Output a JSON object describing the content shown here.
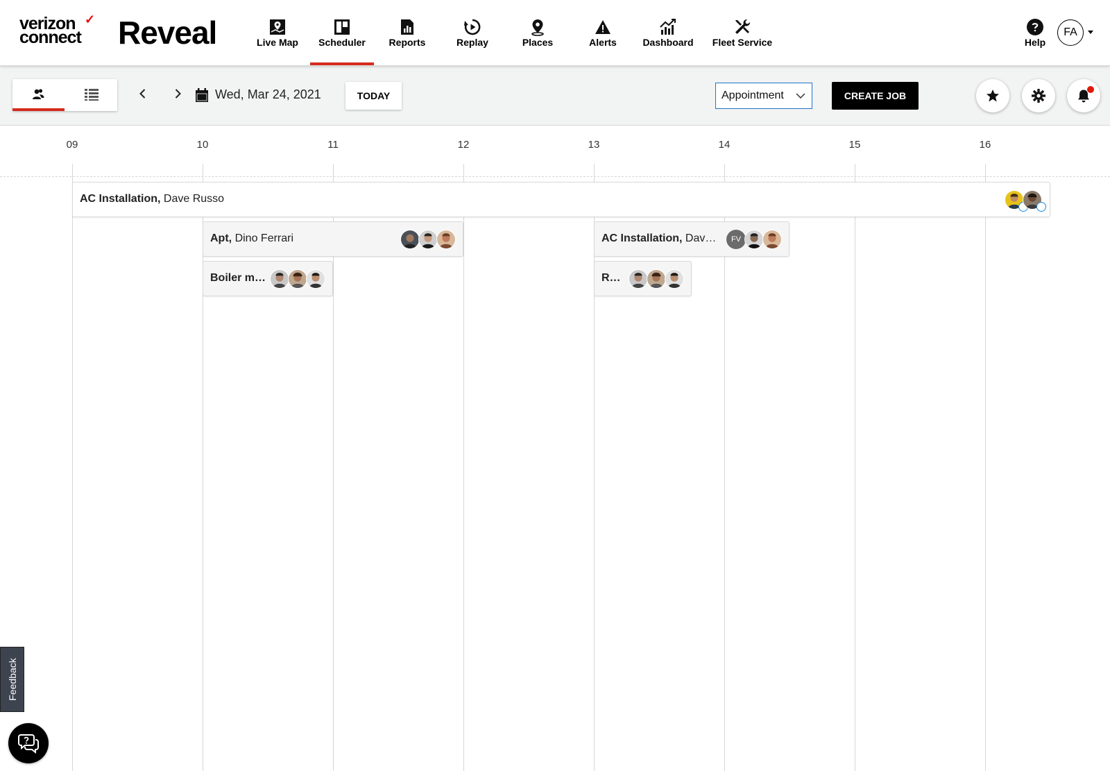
{
  "brand": {
    "line1": "verizon",
    "line2": "connect",
    "check": "✓",
    "product": "Reveal"
  },
  "nav": [
    {
      "label": "Live Map",
      "icon": "map-icon"
    },
    {
      "label": "Scheduler",
      "icon": "scheduler-icon",
      "active": true
    },
    {
      "label": "Reports",
      "icon": "reports-icon"
    },
    {
      "label": "Replay",
      "icon": "replay-icon"
    },
    {
      "label": "Places",
      "icon": "places-icon"
    },
    {
      "label": "Alerts",
      "icon": "alert-icon"
    },
    {
      "label": "Dashboard",
      "icon": "dashboard-icon"
    },
    {
      "label": "Fleet Service",
      "icon": "wrench-icon"
    }
  ],
  "help": {
    "label": "Help"
  },
  "user": {
    "initials": "FA"
  },
  "toolbar": {
    "date": "Wed, Mar 24, 2021",
    "today_label": "TODAY",
    "job_type": "Appointment",
    "create_label": "CREATE JOB"
  },
  "timeline": {
    "hours": [
      "09",
      "10",
      "11",
      "12",
      "13",
      "14",
      "15",
      "16"
    ]
  },
  "jobs": [
    {
      "title": "AC Installation,",
      "customer": "Dave Russo"
    },
    {
      "title": "Apt,",
      "customer": "Dino Ferrari"
    },
    {
      "title": "Boiler m…",
      "customer": ""
    },
    {
      "title": "AC Installation,",
      "customer": "Dav…"
    },
    {
      "title": "R…",
      "customer": ""
    }
  ],
  "assignee_initials": "FV",
  "feedback_label": "Feedback",
  "colors": {
    "accent": "#d52b1e",
    "select_border": "#1e73c9",
    "primary_button": "#000000"
  }
}
